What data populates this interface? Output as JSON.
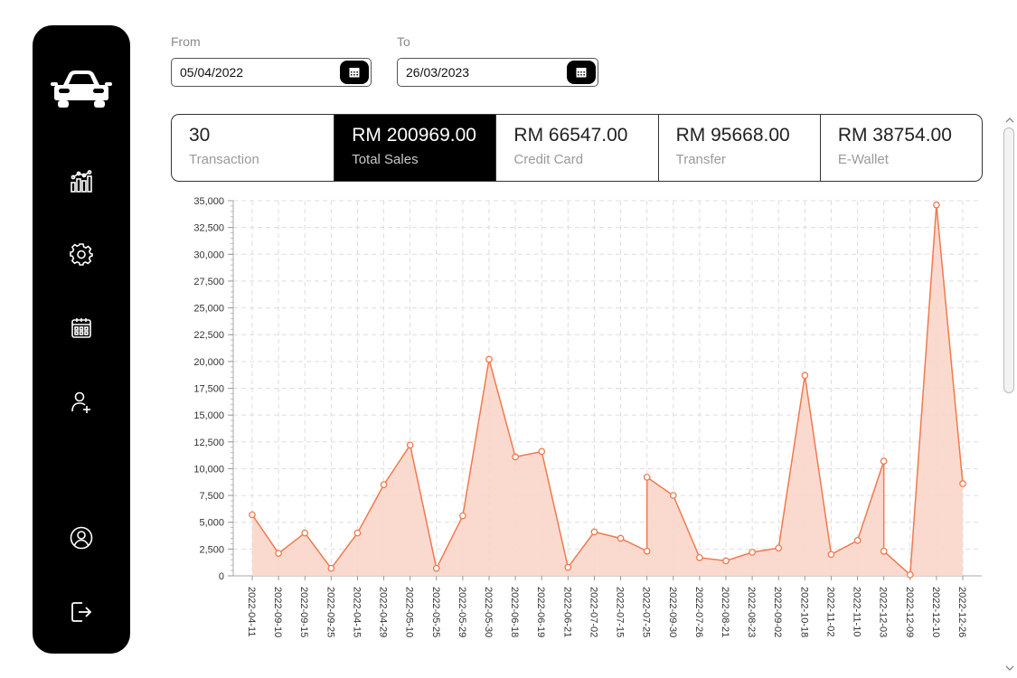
{
  "sidebar": {
    "items": [
      {
        "name": "car-logo-icon"
      },
      {
        "name": "dashboard-chart-icon"
      },
      {
        "name": "settings-gear-icon"
      },
      {
        "name": "calendar-icon"
      },
      {
        "name": "add-user-icon"
      },
      {
        "name": "profile-icon"
      },
      {
        "name": "logout-icon"
      }
    ]
  },
  "filters": {
    "from_label": "From",
    "from_value": "05/04/2022",
    "to_label": "To",
    "to_value": "26/03/2023"
  },
  "stats": [
    {
      "value": "30",
      "label": "Transaction"
    },
    {
      "value": "RM 200969.00",
      "label": "Total Sales"
    },
    {
      "value": "RM 66547.00",
      "label": "Credit Card"
    },
    {
      "value": "RM 95668.00",
      "label": "Transfer"
    },
    {
      "value": "RM 38754.00",
      "label": "E-Wallet"
    }
  ],
  "active_stat_index": 1,
  "colors": {
    "accent": "#000000",
    "series_line": "#f07a4e",
    "series_fill": "#f9d6ca"
  },
  "chart_data": {
    "type": "area",
    "title": "",
    "xlabel": "",
    "ylabel": "",
    "ylim": [
      0,
      35000
    ],
    "yticks": [
      0,
      2500,
      5000,
      7500,
      10000,
      12500,
      15000,
      17500,
      20000,
      22500,
      25000,
      27500,
      30000,
      32500,
      35000
    ],
    "ytick_labels": [
      "0",
      "2,500",
      "5,000",
      "7,500",
      "10,000",
      "12,500",
      "15,000",
      "17,500",
      "20,000",
      "22,500",
      "25,000",
      "27,500",
      "30,000",
      "32,500",
      "35,000"
    ],
    "grid": true,
    "categories": [
      "2022-04-11",
      "2022-09-10",
      "2022-09-15",
      "2022-09-25",
      "2022-04-15",
      "2022-04-29",
      "2022-05-10",
      "2022-05-25",
      "2022-05-29",
      "2022-05-30",
      "2022-06-18",
      "2022-06-19",
      "2022-06-21",
      "2022-07-02",
      "2022-07-15",
      "2022-07-25",
      "2022-09-30",
      "2022-07-26",
      "2022-08-21",
      "2022-08-23",
      "2022-09-02",
      "2022-10-18",
      "2022-11-02",
      "2022-11-10",
      "2022-12-03",
      "2022-12-09",
      "2022-12-10",
      "2022-12-26"
    ],
    "points": [
      {
        "x": "2022-04-11",
        "y": 5700
      },
      {
        "x": "2022-09-10",
        "y": 2100
      },
      {
        "x": "2022-09-15",
        "y": 4000
      },
      {
        "x": "2022-09-25",
        "y": 700
      },
      {
        "x": "2022-04-15",
        "y": 4000
      },
      {
        "x": "2022-04-29",
        "y": 8500
      },
      {
        "x": "2022-05-10",
        "y": 12200
      },
      {
        "x": "2022-05-25",
        "y": 700
      },
      {
        "x": "2022-05-29",
        "y": 5600
      },
      {
        "x": "2022-05-30",
        "y": 20200
      },
      {
        "x": "2022-06-18",
        "y": 11100
      },
      {
        "x": "2022-06-19",
        "y": 11600
      },
      {
        "x": "2022-06-21",
        "y": 800
      },
      {
        "x": "2022-07-02",
        "y": 4100
      },
      {
        "x": "2022-07-15",
        "y": 3500
      },
      {
        "x": "2022-07-25",
        "y": 2300
      },
      {
        "x": "2022-07-25",
        "y": 9200
      },
      {
        "x": "2022-09-30",
        "y": 7500
      },
      {
        "x": "2022-07-26",
        "y": 1700
      },
      {
        "x": "2022-08-21",
        "y": 1400
      },
      {
        "x": "2022-08-23",
        "y": 2200
      },
      {
        "x": "2022-09-02",
        "y": 2600
      },
      {
        "x": "2022-10-18",
        "y": 18700
      },
      {
        "x": "2022-11-02",
        "y": 2000
      },
      {
        "x": "2022-11-10",
        "y": 3300
      },
      {
        "x": "2022-12-03",
        "y": 10700
      },
      {
        "x": "2022-12-03",
        "y": 2300
      },
      {
        "x": "2022-12-09",
        "y": 100
      },
      {
        "x": "2022-12-10",
        "y": 34600
      },
      {
        "x": "2022-12-26",
        "y": 8600
      }
    ]
  }
}
